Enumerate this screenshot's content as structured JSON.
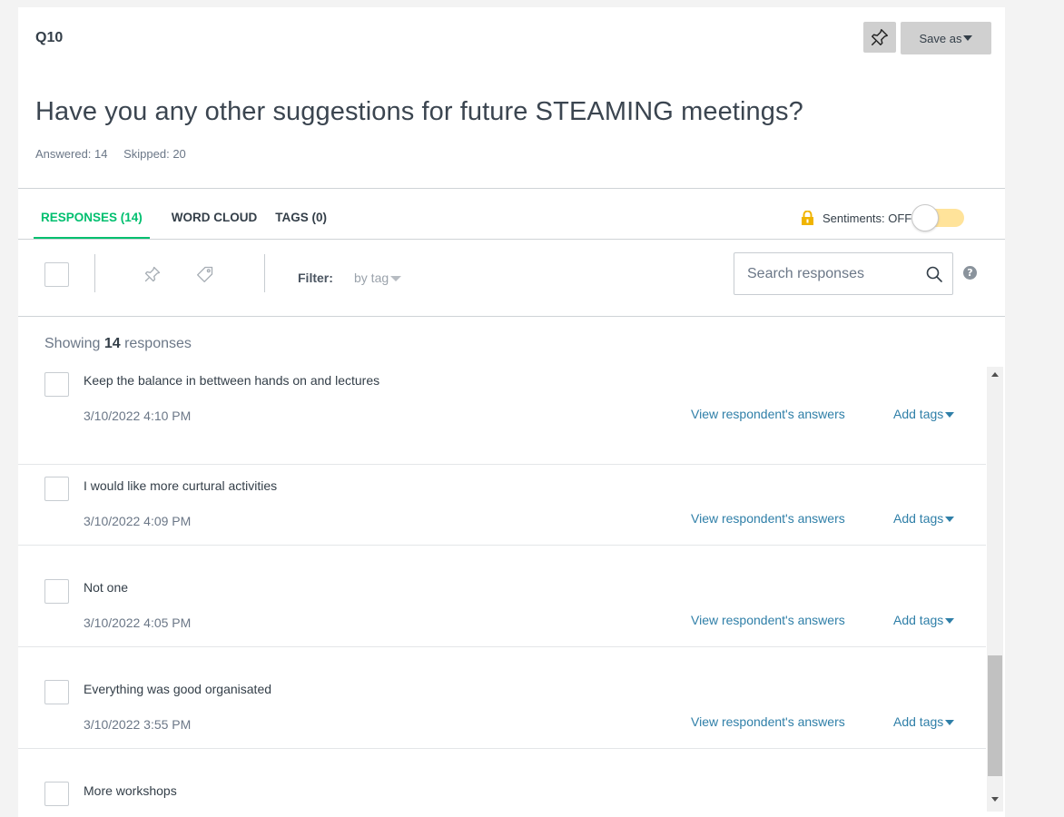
{
  "question": {
    "number": "Q10",
    "title": "Have you any other suggestions for future STEAMING meetings?",
    "answered": "Answered: 14",
    "skipped": "Skipped: 20"
  },
  "header_actions": {
    "pin_icon": "pin-icon",
    "save_as_label": "Save as"
  },
  "tabs": [
    {
      "label": "RESPONSES (14)",
      "active": true
    },
    {
      "label": "WORD CLOUD",
      "active": false
    },
    {
      "label": "TAGS (0)",
      "active": false
    }
  ],
  "sentiments": {
    "label": "Sentiments: OFF",
    "icon": "lock-icon",
    "enabled": false
  },
  "toolbar": {
    "filter_label": "Filter:",
    "filter_value": "by tag",
    "search_placeholder": "Search responses",
    "help": "?"
  },
  "showing": {
    "prefix": "Showing ",
    "count": "14",
    "suffix": " responses"
  },
  "responses": [
    {
      "text": "Keep the balance in bettween hands on and lectures",
      "date": "3/10/2022 4:10 PM",
      "view_label": "View respondent's answers",
      "tags_label": "Add tags"
    },
    {
      "text": "I would like more curtural activities",
      "date": "3/10/2022 4:09 PM",
      "view_label": "View respondent's answers",
      "tags_label": "Add tags"
    },
    {
      "text": "Not one",
      "date": "3/10/2022 4:05 PM",
      "view_label": "View respondent's answers",
      "tags_label": "Add tags"
    },
    {
      "text": "Everything was good organisated",
      "date": "3/10/2022 3:55 PM",
      "view_label": "View respondent's answers",
      "tags_label": "Add tags"
    },
    {
      "text": "More workshops",
      "date": "",
      "view_label": "",
      "tags_label": ""
    }
  ],
  "colors": {
    "accent_green": "#00bf6f",
    "link_blue": "#2f7fa8",
    "toggle_off": "#ffe39a"
  }
}
